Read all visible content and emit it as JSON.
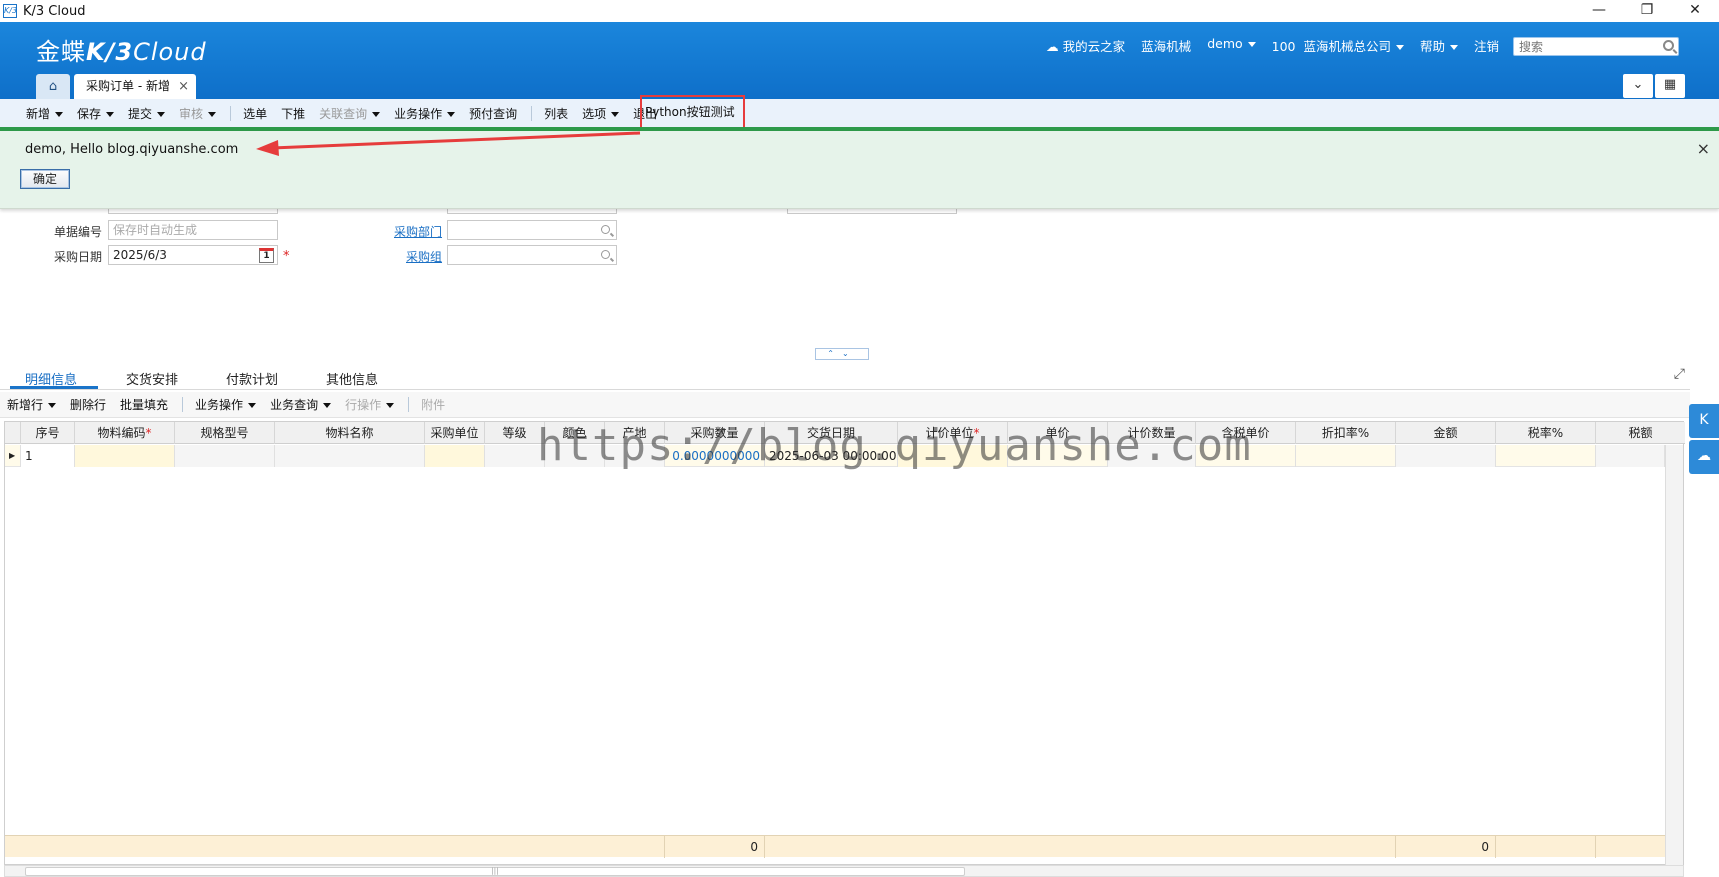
{
  "window": {
    "icon": "K/3",
    "title": "K/3 Cloud",
    "controls": [
      "—",
      "❐",
      "✕"
    ]
  },
  "header": {
    "logo_text": "金蝶",
    "logo_k3": "K/3",
    "logo_cloud": "Cloud",
    "nav": {
      "my_cloud": "我的云之家",
      "org": "蓝海机械",
      "user": "demo",
      "company_code": "100",
      "company": "蓝海机械总公司",
      "help": "帮助",
      "logout": "注销"
    },
    "search_placeholder": "搜索",
    "doc_tab": "采购订单 - 新增",
    "doc_tab_close": "×"
  },
  "toolbar": {
    "new": "新增",
    "save": "保存",
    "submit": "提交",
    "audit": "审核",
    "select_bill": "选单",
    "push_down": "下推",
    "related_query": "关联查询",
    "business_ops": "业务操作",
    "prepay_query": "预付查询",
    "list": "列表",
    "options": "选项",
    "exit": "退出",
    "python_button": "Python按钮测试"
  },
  "message": {
    "text": "demo, Hello blog.qiyuanshe.com",
    "ok": "确定",
    "close": "×"
  },
  "form": {
    "bill_no_label": "单据编号",
    "bill_no_placeholder": "保存时自动生成",
    "date_label": "采购日期",
    "date_value": "2025/6/3",
    "calendar_day": "1",
    "dept_label": "采购部门",
    "group_label": "采购组",
    "required_mark": "*"
  },
  "detail_tabs": [
    "明细信息",
    "交货安排",
    "付款计划",
    "其他信息"
  ],
  "grid_toolbar": {
    "add_row": "新增行",
    "delete_row": "删除行",
    "batch_fill": "批量填充",
    "business_ops": "业务操作",
    "business_query": "业务查询",
    "row_ops": "行操作",
    "attachment": "附件"
  },
  "grid": {
    "columns": [
      "序号",
      "物料编码",
      "规格型号",
      "物料名称",
      "采购单位",
      "等级",
      "颜色",
      "产地",
      "采购数量",
      "交货日期",
      "计价单位",
      "单价",
      "计价数量",
      "含税单价",
      "折扣率%",
      "金额",
      "税率%",
      "税额"
    ],
    "required_columns": [
      "物料编码",
      "计价单位"
    ],
    "row": {
      "seq": "1",
      "quantity": "0.0000000000",
      "delivery_date": "2025-06-03 00:00:00"
    },
    "footer": {
      "quantity_total": "0",
      "amount_total": "0"
    }
  },
  "watermark": "https://blog.qiyuanshe.com",
  "colors": {
    "header_blue": "#1478d2",
    "highlight_red": "#e63c3c",
    "message_green": "#e6f3ea",
    "link_blue": "#1a6fc4"
  }
}
